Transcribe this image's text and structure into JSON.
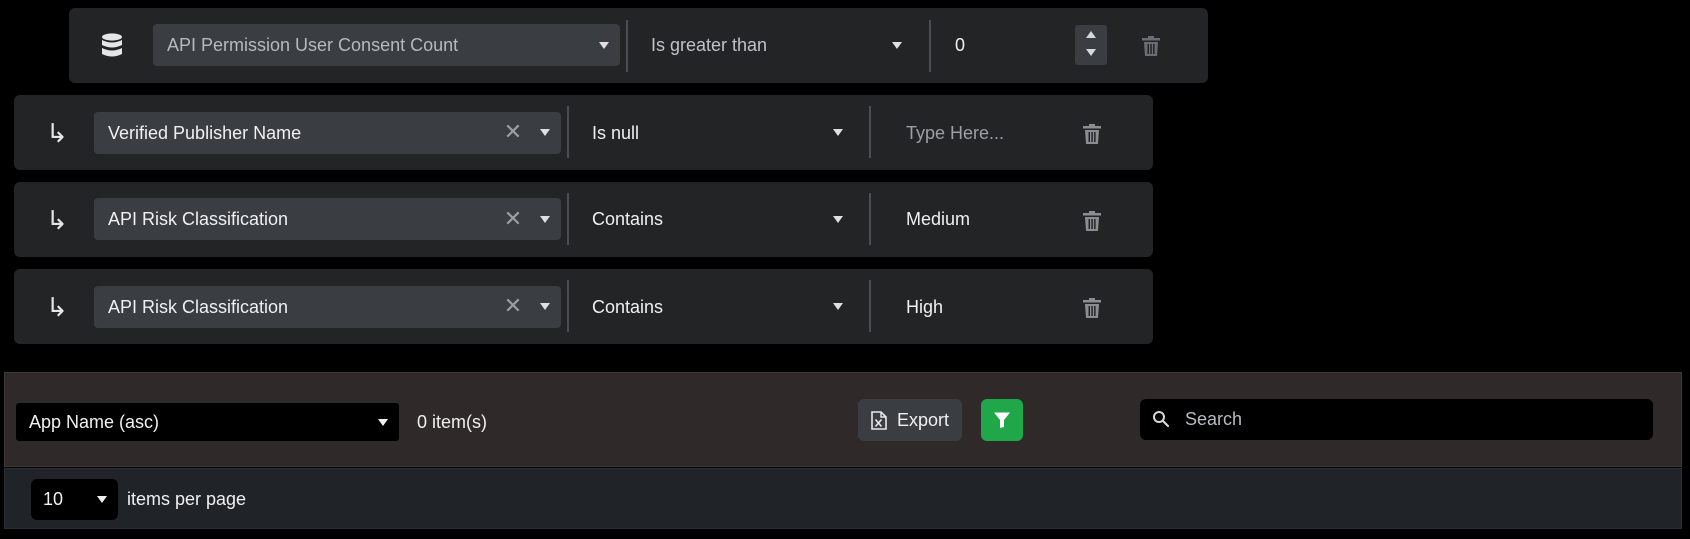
{
  "filters": {
    "parent": {
      "icon": "database-icon",
      "field": "API Permission User Consent Count",
      "operator": "Is greater than",
      "value": "0",
      "stepper_icons": [
        "increment-icon",
        "decrement-icon"
      ],
      "delete_icon": "trash-icon"
    },
    "children": [
      {
        "icon": "sub-condition-arrow-icon",
        "field": "Verified Publisher Name",
        "clear_icon": "clear-icon",
        "operator": "Is null",
        "value_placeholder": "Type Here...",
        "value": "",
        "delete_icon": "trash-icon"
      },
      {
        "icon": "sub-condition-arrow-icon",
        "field": "API Risk Classification",
        "clear_icon": "clear-icon",
        "operator": "Contains",
        "value": "Medium",
        "delete_icon": "trash-icon"
      },
      {
        "icon": "sub-condition-arrow-icon",
        "field": "API Risk Classification",
        "clear_icon": "clear-icon",
        "operator": "Contains",
        "value": "High",
        "delete_icon": "trash-icon"
      }
    ]
  },
  "toolbar": {
    "sort_value": "App Name (asc)",
    "items_count": "0 item(s)",
    "export_label": "Export",
    "export_icon": "excel-export-icon",
    "filter_icon": "filter-icon",
    "search_placeholder": "Search",
    "search_icon": "search-icon"
  },
  "pagination": {
    "per_page_value": "10",
    "per_page_label": "items per page"
  },
  "colors": {
    "page_background": "#000000",
    "row_background": "#232425",
    "select_background": "#3a3d42",
    "toolbar_background": "#2f2a29",
    "footer_background": "#202428",
    "filter_button": "#1fa74a"
  }
}
